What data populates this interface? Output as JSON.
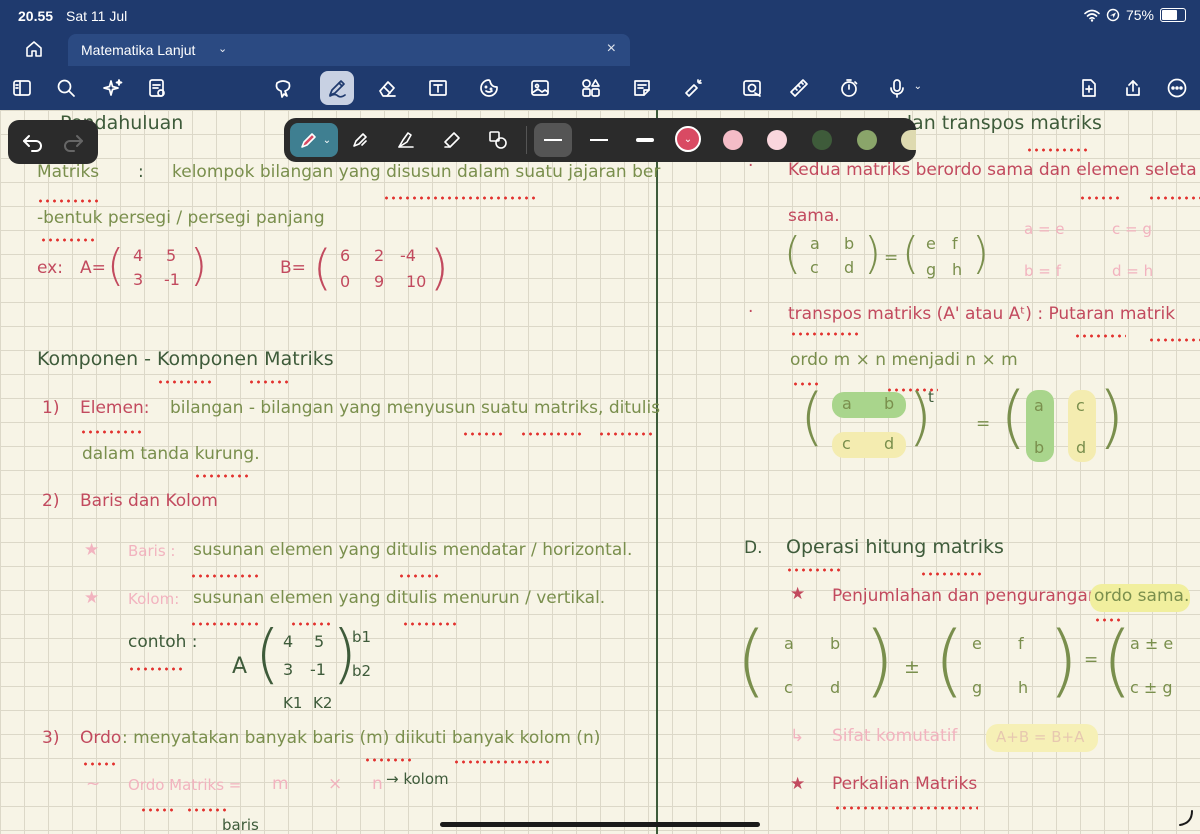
{
  "status_bar": {
    "time": "20.55",
    "date": "Sat 11 Jul",
    "battery": "75%",
    "battery_level": 0.75
  },
  "tab": {
    "title": "Matematika Lanjut",
    "close": "×"
  },
  "toolbar": {
    "icons": [
      "sidebar-icon",
      "search-icon",
      "ai-sparkle-icon",
      "outline-icon",
      "lasso-icon",
      "pen-icon",
      "eraser-icon",
      "text-box-icon",
      "sticker-icon",
      "image-icon",
      "shapes-icon",
      "note-icon",
      "laser-icon",
      "camera-icon",
      "ruler-icon",
      "timer-icon",
      "mic-icon",
      "add-page-icon",
      "share-icon",
      "more-icon"
    ]
  },
  "pen_toolbar": {
    "colors": [
      "#d94a63",
      "#f4bcc7",
      "#f9d6dd",
      "#3e5b3a",
      "#8aa56a",
      "#dedab0"
    ],
    "selected_color": "#d94a63"
  },
  "notes": {
    "left": {
      "section_title": "Pendahuluan",
      "def_term": "Matriks",
      "def_colon": ":",
      "def_line1": "kelompok bilangan yang disusun dalam suatu jajaran ber",
      "def_line2": "-bentuk persegi / persegi panjang",
      "ex_label": "ex:",
      "matrix_a_name": "A=",
      "matrix_a": [
        "4",
        "5",
        "3",
        "-1"
      ],
      "matrix_b_name": "B=",
      "matrix_b": [
        "6",
        "2",
        "-4",
        "0",
        "9",
        "10"
      ],
      "komponen_title": "Komponen - Komponen Matriks",
      "item1_num": "1)",
      "item1_term": "Elemen:",
      "item1_line1": "bilangan - bilangan yang menyusun suatu matriks, ditulis",
      "item1_line2": "dalam tanda kurung.",
      "item2_num": "2)",
      "item2_term": "Baris dan Kolom",
      "baris_label": "Baris :",
      "baris_def": "susunan elemen yang ditulis mendatar / horizontal.",
      "kolom_label": "Kolom:",
      "kolom_def": "susunan elemen yang ditulis menurun / vertikal.",
      "contoh_label": "contoh :",
      "contoh_matrix_name": "A",
      "contoh_matrix": [
        "4",
        "5",
        "3",
        "-1"
      ],
      "row_labels": [
        "b1",
        "b2"
      ],
      "col_labels": [
        "K1",
        "K2"
      ],
      "item3_num": "3)",
      "item3_term": "Ordo",
      "item3_def": ": menyatakan banyak baris (m) diikuti banyak kolom (n)",
      "ordo_arrow": "~",
      "ordo_label": "Ordo Matriks =",
      "ordo_m": "m",
      "ordo_x": "×",
      "ordo_n": "n",
      "ordo_kolom": "→ kolom",
      "ordo_baris": "baris"
    },
    "right": {
      "header_partial": "dan transpos matriks",
      "bullet": "·",
      "kesamaan_line1": "Kedua matriks berordo sama dan elemen seleta",
      "kesamaan_line2": "sama.",
      "eq_left": [
        "a",
        "b",
        "c",
        "d"
      ],
      "eq_right": [
        "e",
        "f",
        "g",
        "h"
      ],
      "eq_sign": "=",
      "eq_notes": [
        "a = e",
        "c = g",
        "b = f",
        "d = h"
      ],
      "transpos_def": "transpos matriks (A' atau Aᵗ) : Putaran matrik",
      "transpos_line2": "ordo m × n menjadi n × m",
      "transpos_left": [
        "a",
        "b",
        "c",
        "d"
      ],
      "transpos_sup": "t",
      "transpos_right": [
        "a",
        "c",
        "b",
        "d"
      ],
      "section_d_num": "D.",
      "section_d_title": "Operasi hitung matriks",
      "penjumlahan": "Penjumlahan dan pengurangan :",
      "penjumlahan_hl": "ordo sama.",
      "sum_left": [
        "a",
        "b",
        "c",
        "d"
      ],
      "sum_op": "±",
      "sum_right": [
        "e",
        "f",
        "g",
        "h"
      ],
      "sum_result": [
        "a ± e",
        "c ± g"
      ],
      "sifat_arrow": "↳",
      "sifat": "Sifat komutatif",
      "sifat_hl": "A+B = B+A",
      "perkalian": "Perkalian Matriks"
    }
  }
}
